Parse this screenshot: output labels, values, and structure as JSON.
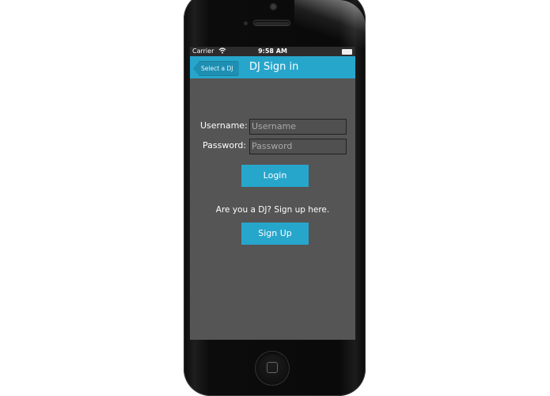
{
  "statusbar": {
    "carrier": "Carrier",
    "wifi_icon": "wifi-icon",
    "time": "9:58 AM",
    "battery_icon": "battery-icon"
  },
  "navbar": {
    "back_label": "Select a DJ",
    "title": "DJ Sign in"
  },
  "form": {
    "username_label": "Username:",
    "username_placeholder": "Username",
    "password_label": "Password:",
    "password_placeholder": "Password",
    "login_label": "Login"
  },
  "signup": {
    "prompt": "Are you a DJ? Sign up here.",
    "button_label": "Sign Up"
  },
  "colors": {
    "accent": "#27a6cc",
    "screen_bg": "#555555",
    "statusbar_bg": "#2c2c2c"
  }
}
